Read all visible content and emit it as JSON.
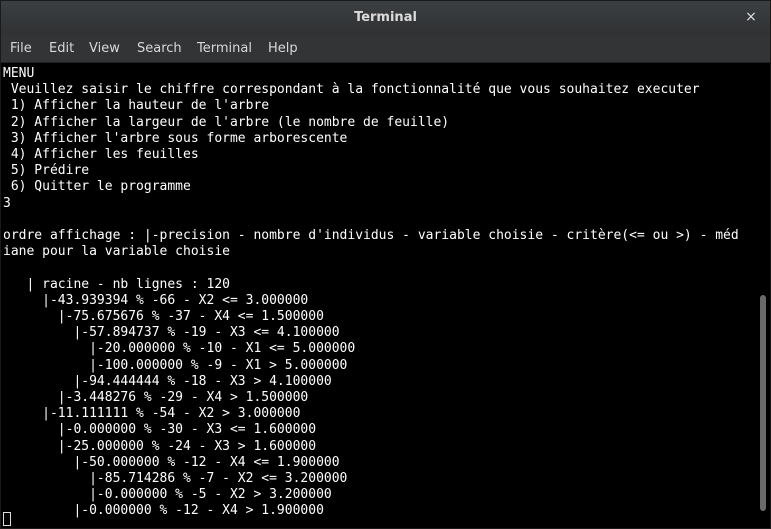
{
  "window": {
    "title": "Terminal",
    "close_glyph": "×"
  },
  "menu": {
    "file": "File",
    "edit": "Edit",
    "view": "View",
    "search": "Search",
    "terminal": "Terminal",
    "help": "Help"
  },
  "terminal": {
    "lines": [
      "MENU",
      " Veuillez saisir le chiffre correspondant à la fonctionnalité que vous souhaitez executer",
      " 1) Afficher la hauteur de l'arbre",
      " 2) Afficher la largeur de l'arbre (le nombre de feuille)",
      " 3) Afficher l'arbre sous forme arborescente",
      " 4) Afficher les feuilles",
      " 5) Prédire",
      " 6) Quitter le programme",
      "3",
      "",
      "ordre affichage : |-precision - nombre d'individus - variable choisie - critère(<= ou >) - méd",
      "iane pour la variable choisie",
      "",
      "   | racine - nb lignes : 120",
      "     |-43.939394 % -66 - X2 <= 3.000000",
      "       |-75.675676 % -37 - X4 <= 1.500000",
      "         |-57.894737 % -19 - X3 <= 4.100000",
      "           |-20.000000 % -10 - X1 <= 5.000000",
      "           |-100.000000 % -9 - X1 > 5.000000",
      "         |-94.444444 % -18 - X3 > 4.100000",
      "       |-3.448276 % -29 - X4 > 1.500000",
      "     |-11.111111 % -54 - X2 > 3.000000",
      "       |-0.000000 % -30 - X3 <= 1.600000",
      "       |-25.000000 % -24 - X3 > 1.600000",
      "         |-50.000000 % -12 - X4 <= 1.900000",
      "           |-85.714286 % -7 - X2 <= 3.200000",
      "           |-0.000000 % -5 - X2 > 3.200000",
      "         |-0.000000 % -12 - X4 > 1.900000"
    ]
  }
}
